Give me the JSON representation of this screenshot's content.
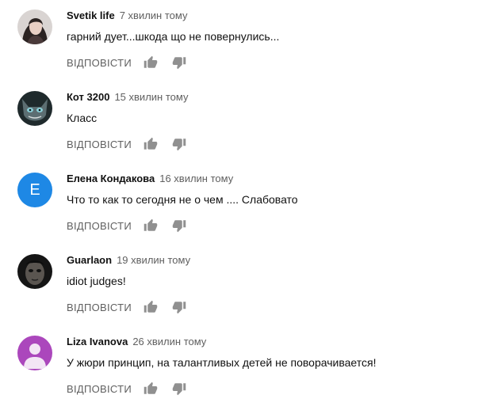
{
  "colors": {
    "author": "#111111",
    "meta": "#606060",
    "icon": "#909090",
    "avatar_elena": "#1e88e5",
    "avatar_liza": "#ab47bc"
  },
  "comments": [
    {
      "author": "Svetik life",
      "time": "7 хвилин тому",
      "text": "гарний дует...шкода що не повернулись...",
      "reply_label": "ВІДПОВІСТИ",
      "avatar": "photo-woman"
    },
    {
      "author": "Кот 3200",
      "time": "15 хвилин тому",
      "text": "Класс",
      "reply_label": "ВІДПОВІСТИ",
      "avatar": "photo-cat"
    },
    {
      "author": "Елена Кондакова",
      "time": "16 хвилин тому",
      "text": "Что то как то сегодня не о чем .... Слабовато",
      "reply_label": "ВІДПОВІСТИ",
      "avatar_letter": "Е"
    },
    {
      "author": "Guarlaon",
      "time": "19 хвилин тому",
      "text": "idiot judges!",
      "reply_label": "ВІДПОВІСТИ",
      "avatar": "photo-face-dark"
    },
    {
      "author": "Liza Ivanova",
      "time": "26 хвилин тому",
      "text": "У жюри принцип, на талантливых детей не поворачивается!",
      "reply_label": "ВІДПОВІСТИ",
      "avatar": "default-person-icon"
    }
  ]
}
